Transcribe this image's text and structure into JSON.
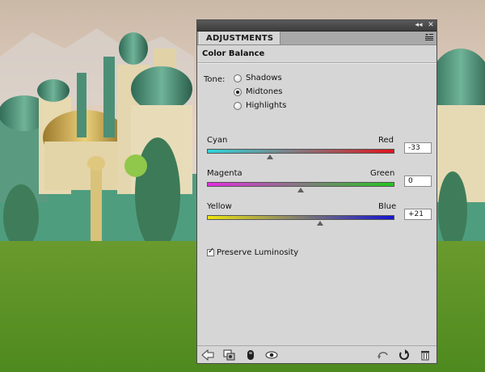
{
  "panel": {
    "tab_label": "ADJUSTMENTS",
    "window_controls": {
      "collapse": "◂◂",
      "close": "✕"
    },
    "title": "Color Balance"
  },
  "tone": {
    "label": "Tone:",
    "options": [
      {
        "label": "Shadows",
        "selected": false
      },
      {
        "label": "Midtones",
        "selected": true
      },
      {
        "label": "Highlights",
        "selected": false
      }
    ]
  },
  "sliders": [
    {
      "left_label": "Cyan",
      "right_label": "Red",
      "value_text": "-33",
      "value": -33,
      "min": -100,
      "max": 100,
      "colors": {
        "left": "#2fd4d9",
        "right": "#e0141d"
      }
    },
    {
      "left_label": "Magenta",
      "right_label": "Green",
      "value_text": "0",
      "value": 0,
      "min": -100,
      "max": 100,
      "colors": {
        "left": "#e32fe0",
        "right": "#23c61f"
      }
    },
    {
      "left_label": "Yellow",
      "right_label": "Blue",
      "value_text": "+21",
      "value": 21,
      "min": -100,
      "max": 100,
      "colors": {
        "left": "#ece40f",
        "right": "#1414d4"
      }
    }
  ],
  "preserve_luminosity": {
    "label": "Preserve Luminosity",
    "checked": true
  },
  "bottom_icons": [
    "back-arrow-icon",
    "clip-to-layer-icon",
    "layer-visibility-eye-icon",
    "view-previous-state-icon",
    "reset-icon",
    "delete-icon"
  ]
}
